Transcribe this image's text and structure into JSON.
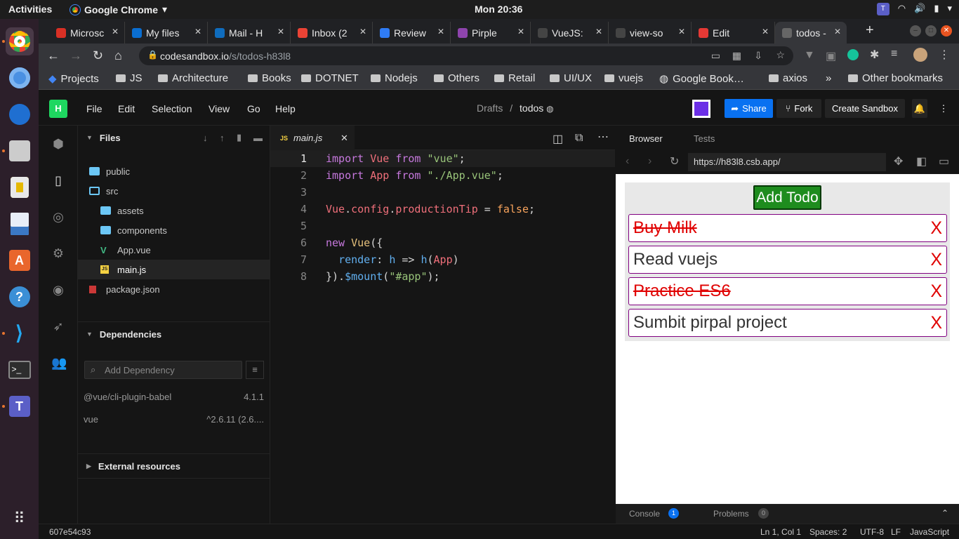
{
  "topbar": {
    "activities": "Activities",
    "app": "Google Chrome",
    "clock": "Mon 20:36"
  },
  "tabs": [
    {
      "label": "Microsc",
      "color": "#d93025"
    },
    {
      "label": "My files",
      "color": "#0a6ed1"
    },
    {
      "label": "Mail - H",
      "color": "#0f6cbd"
    },
    {
      "label": "Inbox (2",
      "color": "#ea4335"
    },
    {
      "label": "Review",
      "color": "#2f7cf6"
    },
    {
      "label": "Pirple",
      "color": "#8e44ad"
    },
    {
      "label": "VueJS:",
      "color": "#444"
    },
    {
      "label": "view-so",
      "color": "#444"
    },
    {
      "label": "Edit",
      "color": "#e53935"
    },
    {
      "label": "todos -",
      "color": "#666"
    }
  ],
  "url": {
    "host": "codesandbox.io",
    "path": "/s/todos-h83l8"
  },
  "bookmarks": [
    "Projects",
    "JS",
    "Architecture",
    "Books",
    "DOTNET",
    "Nodejs",
    "Others",
    "Retail",
    "UI/UX",
    "vuejs",
    "Google Book…",
    "axios",
    "»",
    "Other bookmarks"
  ],
  "csb": {
    "logo": "H",
    "menu": [
      "File",
      "Edit",
      "Selection",
      "View",
      "Go",
      "Help"
    ],
    "crumb_drafts": "Drafts",
    "crumb_sep": "/",
    "crumb_name": "todos",
    "share": "Share",
    "fork": "Fork",
    "create": "Create Sandbox"
  },
  "sidebar": {
    "files_title": "Files",
    "tree": [
      {
        "name": "public",
        "type": "folder",
        "indent": 0
      },
      {
        "name": "src",
        "type": "folder-open",
        "indent": 0
      },
      {
        "name": "assets",
        "type": "folder",
        "indent": 1
      },
      {
        "name": "components",
        "type": "folder",
        "indent": 1
      },
      {
        "name": "App.vue",
        "type": "vue",
        "indent": 1
      },
      {
        "name": "main.js",
        "type": "js",
        "indent": 1
      },
      {
        "name": "package.json",
        "type": "npm",
        "indent": 0
      }
    ],
    "deps_title": "Dependencies",
    "add_dep_placeholder": "Add Dependency",
    "deps": [
      {
        "name": "@vue/cli-plugin-babel",
        "ver": "4.1.1"
      },
      {
        "name": "vue",
        "ver": "^2.6.11 (2.6...."
      }
    ],
    "external": "External resources"
  },
  "editor": {
    "tab": "main.js",
    "tab_icon": "JS",
    "lines": [
      "import Vue from \"vue\";",
      "import App from \"./App.vue\";",
      "",
      "Vue.config.productionTip = false;",
      "",
      "new Vue({",
      "  render: h => h(App)",
      "}).$mount(\"#app\");"
    ]
  },
  "browser": {
    "tab_browser": "Browser",
    "tab_tests": "Tests",
    "url": "https://h83l8.csb.app/",
    "add_todo": "Add Todo",
    "todos": [
      {
        "text": "Buy Milk",
        "done": true
      },
      {
        "text": "Read vuejs",
        "done": false
      },
      {
        "text": "Practice ES6",
        "done": true
      },
      {
        "text": "Sumbit pirpal project",
        "done": false
      }
    ],
    "delete_symbol": "X",
    "console": "Console",
    "console_count": "1",
    "problems": "Problems",
    "problems_count": "0"
  },
  "status": {
    "hash": "607e54c93",
    "pos": "Ln 1, Col 1",
    "spaces": "Spaces: 2",
    "enc": "UTF-8",
    "eol": "LF",
    "lang": "JavaScript"
  }
}
